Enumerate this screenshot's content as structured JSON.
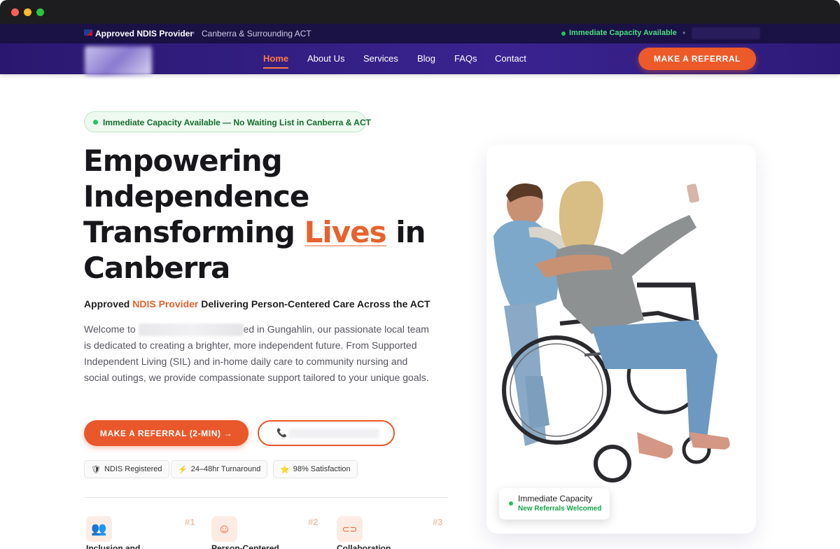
{
  "topbar": {
    "approved": "Approved NDIS Provider",
    "separator": "•",
    "region": "Canberra & Surrounding ACT",
    "capacity": "Immediate Capacity Available"
  },
  "nav": {
    "links": [
      "Home",
      "About Us",
      "Services",
      "Blog",
      "FAQs",
      "Contact"
    ],
    "active": "Home",
    "cta": "MAKE A REFERRAL"
  },
  "hero": {
    "pill": "Immediate Capacity Available — No Waiting List in Canberra & ACT",
    "headline_line1": "Empowering",
    "headline_line2": "Independence",
    "headline_line3_pre": "Transforming ",
    "headline_line3_highlight": "Lives",
    "headline_line3_post": " in",
    "headline_line4": "Canberra",
    "subhead_pre": "Approved ",
    "subhead_accent": "NDIS Provider",
    "subhead_post": " Delivering Person-Centered Care Across the ACT",
    "para_pre": "Welcome to ",
    "para_post": "ed in Gungahlin, our passionate local team is dedicated to creating a brighter, more independent future. From Supported Independent Living (SIL) and in-home daily care to community nursing and social outings, we provide compassionate support tailored to your unique goals.",
    "cta_primary": "MAKE A REFERRAL (2-MIN) →",
    "phone_icon": "📞"
  },
  "badges": [
    {
      "icon": "🛡",
      "label": "NDIS Registered"
    },
    {
      "icon": "⚡",
      "label": "24–48hr Turnaround"
    },
    {
      "icon": "⭐",
      "label": "98% Satisfaction"
    }
  ],
  "features": [
    {
      "icon": "users-icon",
      "glyph": "👥",
      "num": "#1",
      "title": "Inclusion and"
    },
    {
      "icon": "smile-icon",
      "glyph": "☺",
      "num": "#2",
      "title": "Person-Centered"
    },
    {
      "icon": "link-icon",
      "glyph": "⊂⊃",
      "num": "#3",
      "title": "Collaboration"
    }
  ],
  "capacity_card": {
    "title": "Immediate Capacity",
    "subtitle": "New Referrals Welcomed"
  },
  "colors": {
    "accent": "#e8622e",
    "nav_bg": "#2f1c80",
    "topbar_bg": "#1a1145",
    "success": "#22c55e"
  }
}
